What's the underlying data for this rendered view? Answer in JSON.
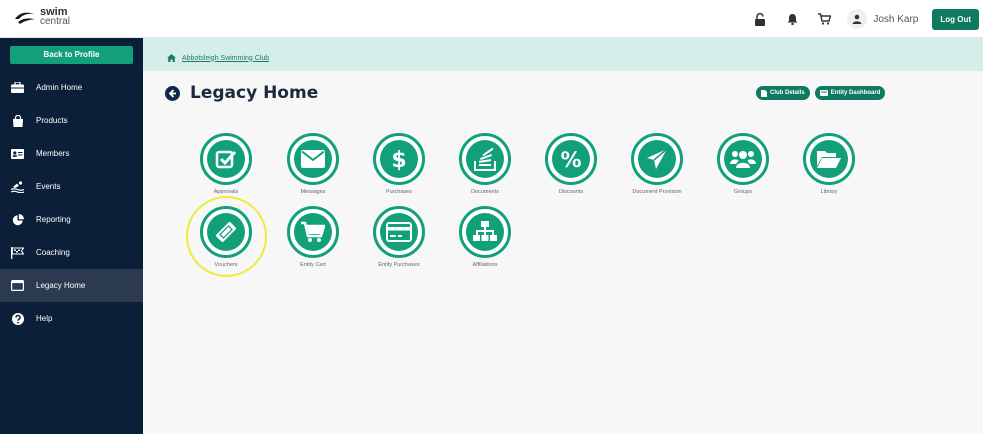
{
  "logo": {
    "line1": "swim",
    "line2": "central"
  },
  "topbar": {
    "icons": [
      "lock-open-icon",
      "bell-icon",
      "cart-icon",
      "user-icon"
    ],
    "user_name": "Josh Karp",
    "logout_label": "Log Out"
  },
  "sidebar": {
    "back_label": "Back to Profile",
    "items": [
      {
        "label": "Admin Home",
        "icon": "briefcase-icon"
      },
      {
        "label": "Products",
        "icon": "shopping-bag-icon"
      },
      {
        "label": "Members",
        "icon": "id-card-icon"
      },
      {
        "label": "Events",
        "icon": "swimmer-icon"
      },
      {
        "label": "Reporting",
        "icon": "pie-chart-icon"
      },
      {
        "label": "Coaching",
        "icon": "flag-icon"
      },
      {
        "label": "Legacy Home",
        "icon": "window-icon",
        "active": true
      },
      {
        "label": "Help",
        "icon": "question-icon"
      }
    ]
  },
  "breadcrumb": {
    "label": "Abbotsleigh Swimming Club"
  },
  "page": {
    "title": "Legacy Home"
  },
  "header_buttons": {
    "club_details": "Club Details",
    "entity_dashboard": "Entity Dashboard"
  },
  "tiles": [
    {
      "label": "Approvals",
      "icon": "checkbox-icon"
    },
    {
      "label": "Messages",
      "icon": "envelope-icon"
    },
    {
      "label": "Purchases",
      "icon": "dollar-icon"
    },
    {
      "label": "Documents",
      "icon": "documents-icon"
    },
    {
      "label": "Discounts",
      "icon": "percent-icon"
    },
    {
      "label": "Document Provision",
      "icon": "paper-plane-icon"
    },
    {
      "label": "Groups",
      "icon": "users-icon"
    },
    {
      "label": "Library",
      "icon": "folder-open-icon"
    },
    {
      "label": "Vouchers",
      "icon": "ticket-icon"
    },
    {
      "label": "Entity Cart",
      "icon": "cart-icon"
    },
    {
      "label": "Entity Purchases",
      "icon": "credit-card-icon"
    },
    {
      "label": "Affiliations",
      "icon": "sitemap-icon"
    }
  ],
  "colors": {
    "accent": "#12a07a",
    "sidebar": "#0b2038",
    "highlight": "#ecec3a"
  }
}
